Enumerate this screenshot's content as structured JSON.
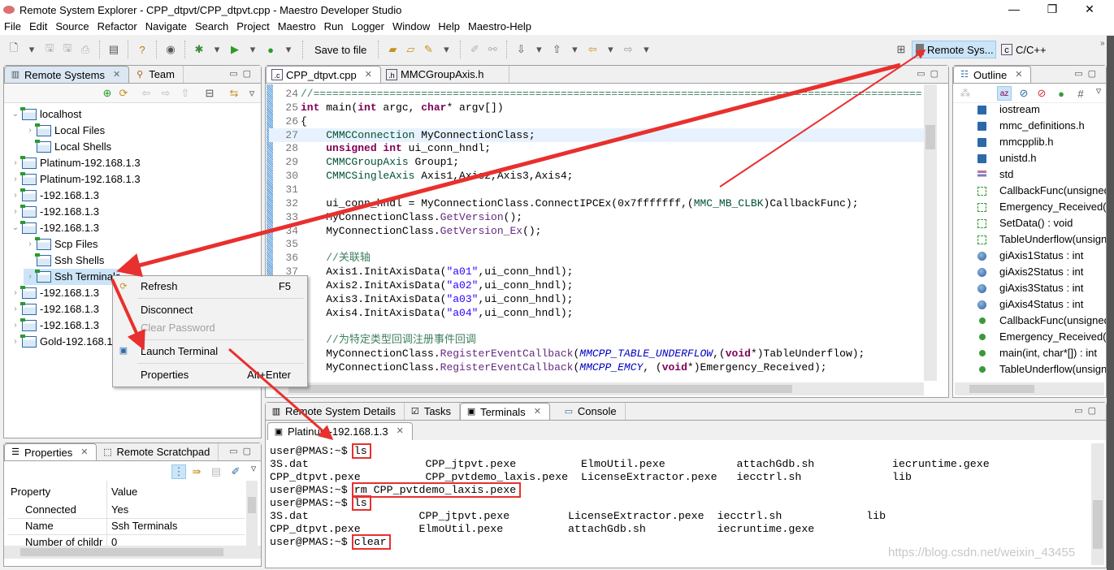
{
  "window": {
    "title": "Remote System Explorer - CPP_dtpvt/CPP_dtpvt.cpp - Maestro Developer Studio",
    "minimize": "—",
    "maximize": "❐",
    "close": "✕"
  },
  "menu": [
    "File",
    "Edit",
    "Source",
    "Refactor",
    "Navigate",
    "Search",
    "Project",
    "Maestro",
    "Run",
    "Logger",
    "Window",
    "Help",
    "Maestro-Help"
  ],
  "toolbar": {
    "save_to_file": "Save to file",
    "perspectives": [
      {
        "label": "Remote Sys...",
        "active": true
      },
      {
        "label": "C/C++",
        "active": false
      }
    ]
  },
  "left_panel": {
    "tabs": [
      {
        "label": "Remote Systems",
        "active": true
      },
      {
        "label": "Team",
        "active": false
      }
    ],
    "tree": [
      {
        "label": "localhost",
        "depth": 0,
        "twisty": "open"
      },
      {
        "label": "Local Files",
        "depth": 1,
        "twisty": "closed"
      },
      {
        "label": "Local Shells",
        "depth": 1,
        "twisty": "none"
      },
      {
        "label": "Platinum-192.168.1.3",
        "depth": 0,
        "twisty": "closed"
      },
      {
        "label": "Platinum-192.168.1.3",
        "depth": 0,
        "twisty": "closed"
      },
      {
        "label": "-192.168.1.3",
        "depth": 0,
        "twisty": "closed"
      },
      {
        "label": "-192.168.1.3",
        "depth": 0,
        "twisty": "closed"
      },
      {
        "label": "-192.168.1.3",
        "depth": 0,
        "twisty": "open"
      },
      {
        "label": "Scp Files",
        "depth": 1,
        "twisty": "closed"
      },
      {
        "label": "Ssh Shells",
        "depth": 1,
        "twisty": "none"
      },
      {
        "label": "Ssh Terminals",
        "depth": 1,
        "twisty": "closed",
        "selected": true
      },
      {
        "label": "-192.168.1.3",
        "depth": 0,
        "twisty": "closed"
      },
      {
        "label": "-192.168.1.3",
        "depth": 0,
        "twisty": "closed"
      },
      {
        "label": "-192.168.1.3",
        "depth": 0,
        "twisty": "closed"
      },
      {
        "label": "Gold-192.168.1.3",
        "depth": 0,
        "twisty": "closed"
      }
    ]
  },
  "context_menu": {
    "refresh": "Refresh",
    "refresh_shortcut": "F5",
    "disconnect": "Disconnect",
    "clear_password": "Clear Password",
    "launch_terminal": "Launch Terminal",
    "properties": "Properties",
    "properties_shortcut": "Alt+Enter"
  },
  "properties_panel": {
    "tabs": [
      {
        "label": "Properties",
        "active": true
      },
      {
        "label": "Remote Scratchpad",
        "active": false
      }
    ],
    "columns": [
      "Property",
      "Value"
    ],
    "rows": [
      {
        "property": "Connected",
        "value": "Yes"
      },
      {
        "property": "Name",
        "value": "Ssh Terminals"
      },
      {
        "property": "Number of childr",
        "value": "0"
      }
    ]
  },
  "editor": {
    "tabs": [
      {
        "label": "CPP_dtpvt.cpp",
        "active": true
      },
      {
        "label": "MMCGroupAxis.h",
        "active": false
      }
    ],
    "lines": [
      {
        "n": 24,
        "seg": [
          [
            "cm",
            "//================================================================================================"
          ]
        ]
      },
      {
        "n": 25,
        "seg": [
          [
            "k",
            "int"
          ],
          [
            "p",
            " main("
          ],
          [
            "k",
            "int"
          ],
          [
            "p",
            " argc, "
          ],
          [
            "k",
            "char"
          ],
          [
            "p",
            "* argv[])"
          ]
        ]
      },
      {
        "n": 26,
        "seg": [
          [
            "p",
            "{"
          ]
        ]
      },
      {
        "n": 27,
        "hl": true,
        "seg": [
          [
            "p",
            "    "
          ],
          [
            "t",
            "CMMCConnection"
          ],
          [
            "p",
            " MyConnectionClass;"
          ]
        ]
      },
      {
        "n": 28,
        "seg": [
          [
            "p",
            "    "
          ],
          [
            "k",
            "unsigned int"
          ],
          [
            "p",
            " ui_conn_hndl;"
          ]
        ]
      },
      {
        "n": 29,
        "seg": [
          [
            "p",
            "    "
          ],
          [
            "t",
            "CMMCGroupAxis"
          ],
          [
            "p",
            " Group1;"
          ]
        ]
      },
      {
        "n": 30,
        "seg": [
          [
            "p",
            "    "
          ],
          [
            "t",
            "CMMCSingleAxis"
          ],
          [
            "p",
            " Axis1,Axis2,Axis3,Axis4;"
          ]
        ]
      },
      {
        "n": 31,
        "seg": []
      },
      {
        "n": 32,
        "seg": [
          [
            "p",
            "    ui_conn_hndl = MyConnectionClass.ConnectIPCEx(0x7fffffff,("
          ],
          [
            "t",
            "MMC_MB_CLBK"
          ],
          [
            "p",
            ")CallbackFunc);"
          ]
        ]
      },
      {
        "n": 33,
        "seg": [
          [
            "p",
            "    MyConnectionClass."
          ],
          [
            "m",
            "GetVersion"
          ],
          [
            "p",
            "();"
          ]
        ]
      },
      {
        "n": 34,
        "seg": [
          [
            "p",
            "    MyConnectionClass."
          ],
          [
            "m",
            "GetVersion_Ex"
          ],
          [
            "p",
            "();"
          ]
        ]
      },
      {
        "n": 35,
        "seg": []
      },
      {
        "n": 36,
        "seg": [
          [
            "p",
            "    "
          ],
          [
            "cm",
            "//关联轴"
          ]
        ]
      },
      {
        "n": 37,
        "seg": [
          [
            "p",
            "    Axis1.InitAxisData("
          ],
          [
            "s",
            "\"a01\""
          ],
          [
            "p",
            ",ui_conn_hndl);"
          ]
        ]
      },
      {
        "n": 38,
        "seg": [
          [
            "p",
            "    Axis2.InitAxisData("
          ],
          [
            "s",
            "\"a02\""
          ],
          [
            "p",
            ",ui_conn_hndl);"
          ]
        ]
      },
      {
        "n": 39,
        "seg": [
          [
            "p",
            "    Axis3.InitAxisData("
          ],
          [
            "s",
            "\"a03\""
          ],
          [
            "p",
            ",ui_conn_hndl);"
          ]
        ]
      },
      {
        "n": 40,
        "seg": [
          [
            "p",
            "    Axis4.InitAxisData("
          ],
          [
            "s",
            "\"a04\""
          ],
          [
            "p",
            ",ui_conn_hndl);"
          ]
        ]
      },
      {
        "n": 41,
        "seg": []
      },
      {
        "n": 42,
        "seg": [
          [
            "p",
            "    "
          ],
          [
            "cm",
            "//为特定类型回调注册事件回调"
          ]
        ]
      },
      {
        "n": 43,
        "seg": [
          [
            "p",
            "    MyConnectionClass."
          ],
          [
            "m",
            "RegisterEventCallback"
          ],
          [
            "p",
            "("
          ],
          [
            "mc",
            "MMCPP_TABLE_UNDERFLOW"
          ],
          [
            "p",
            ",("
          ],
          [
            "k",
            "void"
          ],
          [
            "p",
            "*)TableUnderflow);"
          ]
        ]
      },
      {
        "n": 44,
        "seg": [
          [
            "p",
            "    MyConnectionClass."
          ],
          [
            "m",
            "RegisterEventCallback"
          ],
          [
            "p",
            "("
          ],
          [
            "mc",
            "MMCPP_EMCY"
          ],
          [
            "p",
            ", ("
          ],
          [
            "k",
            "void"
          ],
          [
            "p",
            "*)Emergency_Received);"
          ]
        ]
      }
    ]
  },
  "outline": {
    "tab": "Outline",
    "items": [
      {
        "label": "iostream",
        "icon": "include-icon"
      },
      {
        "label": "mmc_definitions.h",
        "icon": "include-icon"
      },
      {
        "label": "mmcpplib.h",
        "icon": "include-icon"
      },
      {
        "label": "unistd.h",
        "icon": "include-icon"
      },
      {
        "label": "std",
        "icon": "namespace-icon"
      },
      {
        "label": "CallbackFunc(unsigned",
        "icon": "function-declaration-icon"
      },
      {
        "label": "Emergency_Received(u",
        "icon": "function-declaration-icon"
      },
      {
        "label": "SetData() : void",
        "icon": "function-declaration-icon"
      },
      {
        "label": "TableUnderflow(unsign",
        "icon": "function-declaration-icon"
      },
      {
        "label": "giAxis1Status : int",
        "icon": "variable-icon"
      },
      {
        "label": "giAxis2Status : int",
        "icon": "variable-icon"
      },
      {
        "label": "giAxis3Status : int",
        "icon": "variable-icon"
      },
      {
        "label": "giAxis4Status : int",
        "icon": "variable-icon"
      },
      {
        "label": "CallbackFunc(unsigned",
        "icon": "function-icon"
      },
      {
        "label": "Emergency_Received(u",
        "icon": "function-icon"
      },
      {
        "label": "main(int, char*[]) : int",
        "icon": "function-icon"
      },
      {
        "label": "TableUnderflow(unsign",
        "icon": "function-icon"
      }
    ]
  },
  "bottom_panel": {
    "tabs": [
      {
        "label": "Remote System Details",
        "active": false
      },
      {
        "label": "Tasks",
        "active": false
      },
      {
        "label": "Terminals",
        "active": true
      },
      {
        "label": "Console",
        "active": false
      }
    ],
    "terminal_tab": "Platinum-192.168.1.3",
    "lines": [
      {
        "text": "user@PMAS:~$ ls",
        "cmd": "ls",
        "boxed": true
      },
      {
        "text": "3S.dat                  CPP_jtpvt.pexe          ElmoUtil.pexe           attachGdb.sh            iecruntime.gexe"
      },
      {
        "text": "CPP_dtpvt.pexe          CPP_pvtdemo_laxis.pexe  LicenseExtractor.pexe   iecctrl.sh              lib"
      },
      {
        "text": "user@PMAS:~$ rm CPP_pvtdemo_laxis.pexe",
        "cmd": "rm CPP_pvtdemo_laxis.pexe",
        "boxed": true
      },
      {
        "text": "user@PMAS:~$ ls",
        "cmd": "ls",
        "boxed": true
      },
      {
        "text": "3S.dat                 CPP_jtpvt.pexe         LicenseExtractor.pexe  iecctrl.sh             lib"
      },
      {
        "text": "CPP_dtpvt.pexe         ElmoUtil.pexe          attachGdb.sh           iecruntime.gexe"
      },
      {
        "text": "user@PMAS:~$ clear",
        "cmd": "clear",
        "boxed": true
      }
    ],
    "watermark": "https://blog.csdn.net/weixin_43455"
  },
  "colors": {
    "annotation_red": "#e8302e",
    "selection": "#cce4f7",
    "current_line": "#e8f2fe"
  }
}
